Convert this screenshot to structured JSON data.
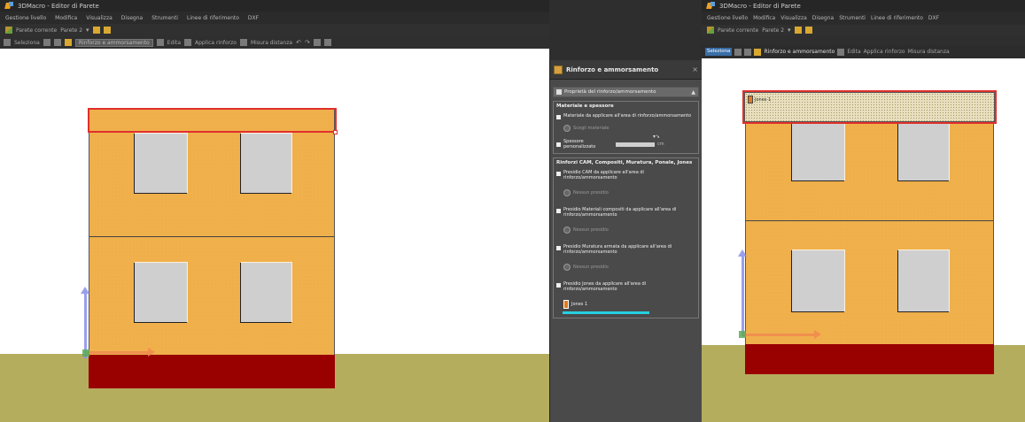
{
  "left_window": {
    "title": "3DMacro - Editor di Parete",
    "menu": [
      "Gestione livello",
      "Modifica",
      "Visualizza",
      "Disegna",
      "Strumenti",
      "Linee di riferimento",
      "DXF"
    ],
    "toolbar1": {
      "wall_label": "Parete corrente",
      "wall_value": "Parete 2"
    },
    "toolbar2": {
      "select_label": "Seleziona",
      "combo_value": "Rinforzo e ammorsamento",
      "edit_label": "Edita",
      "apply_label": "Applica rinforzo",
      "tools_label": "Misura distanza"
    }
  },
  "right_window": {
    "title": "3DMacro - Editor di Parete",
    "menu": [
      "Gestione livello",
      "Modifica",
      "Visualizza",
      "Disegna",
      "Strumenti",
      "Linee di riferimento",
      "DXF"
    ],
    "toolbar1": {
      "wall_label": "Parete corrente",
      "wall_value": "Parete 2"
    },
    "toolbar2": {
      "select_label": "Seleziona",
      "combo_value": "Rinforzo e ammorsamento",
      "edit_label": "Edita",
      "apply_label": "Applica rinforzo",
      "tools_label": "Misura distanza"
    },
    "selected_label": "Jones 1"
  },
  "panel": {
    "title": "Rinforzo e ammorsamento",
    "section_title": "Proprietà del rinforzo/ammorsamento",
    "group1_title": "Materiale e spessore",
    "opt_material": "Materiale da applicare all'area di rinforzo/ammorsamento",
    "material_placeholder": "Scegli materiale",
    "opt_thickness": "Spessore personalizzato",
    "thickness_unit": "cm",
    "group2_title": "Rinforzi CAM, Compositi, Muratura, Ponale, Jones",
    "opt_cam": "Presidio CAM da applicare all'area di rinforzo/ammorsamento",
    "cam_placeholder": "Nessun presidio",
    "opt_composite": "Presidio Materiali compositi da applicare all'area di rinforzo/ammorsamento",
    "composite_placeholder": "Nessun presidio",
    "opt_masonry": "Presidio Muratura armata da applicare all'area di rinforzo/ammorsamento",
    "masonry_placeholder": "Nessun presidio",
    "opt_jones": "Presidio Jones da applicare all'area di rinforzo/ammorsamento",
    "jones_value": "Jones 1"
  },
  "colors": {
    "facade": "#f0b04c",
    "foundation": "#990000",
    "ground": "#b5ad5e",
    "selection": "#e0302c",
    "accent": "#26d0e0"
  }
}
